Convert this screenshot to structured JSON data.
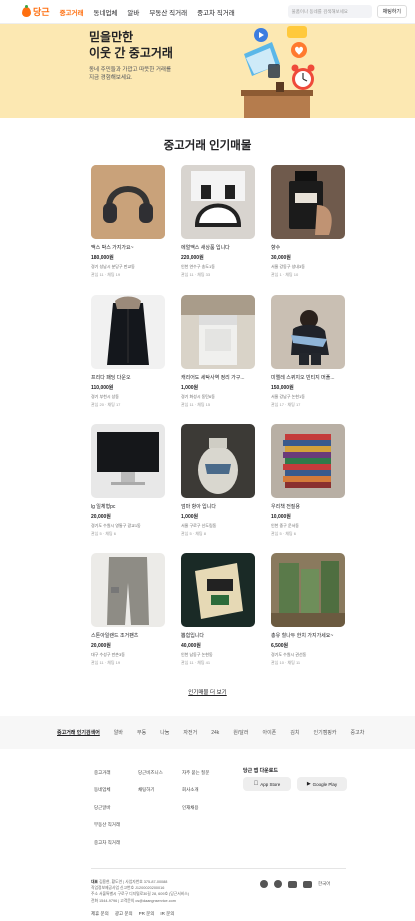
{
  "header": {
    "logo": "당근",
    "nav": [
      "중고거래",
      "동네업체",
      "알바",
      "부동산 직거래",
      "중고차 직거래"
    ],
    "search_placeholder": "물품이나 동네를 검색해보세요",
    "chat_label": "채팅하기"
  },
  "hero": {
    "title_line1": "믿을만한",
    "title_line2": "이웃 간 중고거래",
    "desc_line1": "동네 주민들과 가깝고 따뜻한 거래를",
    "desc_line2": "지금 경험해보세요."
  },
  "section_title": "중고거래 인기매물",
  "items": [
    {
      "title": "맥스 박스 가지가요~",
      "price": "180,000원",
      "loc": "경기 성남시 분당구 판교동",
      "stat": "관심 11 · 채팅 19"
    },
    {
      "title": "에얼맥스 새상품 입니다",
      "price": "220,000원",
      "loc": "인천 연수구 송도1동",
      "stat": "관심 11 · 채팅 33"
    },
    {
      "title": "향수",
      "price": "30,000원",
      "loc": "서울 강동구 성내3동",
      "stat": "관심 1 · 채팅 10"
    },
    {
      "title": "프리다 패딩 다운오",
      "price": "110,000원",
      "loc": "경기 부천시 상동",
      "stat": "관심 20 · 채팅 17"
    },
    {
      "title": "캐리어도 세탁사역 정리 가구...",
      "price": "1,000원",
      "loc": "경기 화성시 동탄6동",
      "stat": "관심 11 · 채팅 15"
    },
    {
      "title": "미엘레 스퀴지오 빈티지 머플...",
      "price": "150,000원",
      "loc": "서울 강남구 논현1동",
      "stat": "관심 17 · 채팅 17"
    },
    {
      "title": "lg 일체형pc",
      "price": "20,000원",
      "loc": "경기도 수원시 영통구 광교1동",
      "stat": "관심 5 · 채팅 6"
    },
    {
      "title": "엄마 항아 입니다",
      "price": "1,000원",
      "loc": "서울 구로구 신도림동",
      "stat": "관심 5 · 채팅 8"
    },
    {
      "title": "우리책 전질용",
      "price": "10,000원",
      "loc": "인천 중구 운서동",
      "stat": "관심 5 · 채팅 6"
    },
    {
      "title": "스톤아일랜드 조거팬츠",
      "price": "20,000원",
      "loc": "대구 수성구 만촌3동",
      "stat": "관심 11 · 채팅 19"
    },
    {
      "title": "뽑힘입니다",
      "price": "40,000원",
      "loc": "인천 남동구 논현동",
      "stat": "관심 11 · 채팅 41"
    },
    {
      "title": "총유 힐나두 한치 가지가세요~",
      "price": "6,500원",
      "loc": "경기도 수원시 권선동",
      "stat": "관심 10 · 채팅 11"
    }
  ],
  "more_label": "인기매물 더 보기",
  "footer_tabs": [
    "중고거래 인기검색어",
    "알바",
    "부동",
    "나눔",
    "자전거",
    "24k",
    "원/달러",
    "아이폰",
    "김치",
    "인기캠핑카",
    "중고차"
  ],
  "footer_links": [
    "중고거래",
    "동네업체",
    "당근알바",
    "부동산 직거래",
    "중고차 직거래",
    "당근비즈니스",
    "채팅하기",
    "자주 묻는 질문",
    "회사소개",
    "인재채용"
  ],
  "app_download": {
    "title": "당근 앱 다운로드",
    "app_store": "App Store",
    "google_play": "Google Play"
  },
  "biz": {
    "line1_label": "대표",
    "line1": "김용현, 황도연 | 사업자번호 375-87-00088",
    "line2": "직업정보제공사업 신고번호 J1200020200016",
    "line3": "주소 서울특별시 구로구 디지털로30길 28, 609호 (당근서비스)",
    "line4": "전화 1544-9796 | 고객문의 cs@daangnservice.com"
  },
  "lang": "한국어",
  "policies": [
    "제휴 문의",
    "광고 문의",
    "PR 문의",
    "IR 문의"
  ]
}
